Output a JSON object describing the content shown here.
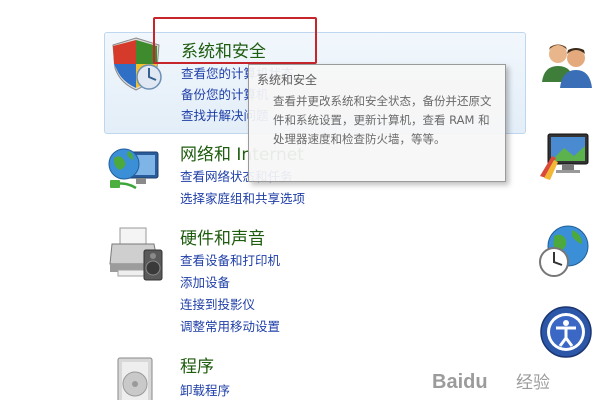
{
  "categories": {
    "security": {
      "title": "系统和安全",
      "links": [
        "查看您的计算机状态",
        "备份您的计算机",
        "查找并解决问题"
      ]
    },
    "network": {
      "title": "网络和 Internet",
      "links": [
        "查看网络状态和任务",
        "选择家庭组和共享选项"
      ]
    },
    "hardware": {
      "title": "硬件和声音",
      "links": [
        "查看设备和打印机",
        "添加设备",
        "连接到投影仪",
        "调整常用移动设置"
      ]
    },
    "programs": {
      "title": "程序",
      "links": [
        "卸载程序"
      ]
    }
  },
  "tooltip": {
    "title": "系统和安全",
    "body": "查看并更改系统和安全状态，备份并还原文件和系统设置，更新计算机，查看 RAM 和处理器速度和检查防火墙，等等。"
  },
  "watermark": {
    "brand": "Baidu",
    "suffix": "经验"
  },
  "icons": {
    "security": "shield-icon",
    "network": "globe-network-icon",
    "hardware": "printer-icon",
    "programs": "programs-icon",
    "users": "user-accounts-icon",
    "appearance": "monitor-appearance-icon",
    "clock": "clock-region-icon",
    "ease": "ease-of-access-icon"
  },
  "colors": {
    "title": "#1e5c0e",
    "link": "#1f3fa7",
    "highlight": "#c6262b"
  }
}
